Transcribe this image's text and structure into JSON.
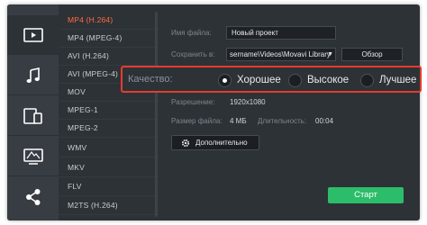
{
  "sidebar": {
    "tabs": [
      {
        "icon": "video-icon",
        "active": true
      },
      {
        "icon": "music-icon",
        "active": false
      },
      {
        "icon": "devices-icon",
        "active": false
      },
      {
        "icon": "tv-icon",
        "active": false
      },
      {
        "icon": "share-icon",
        "active": false
      }
    ]
  },
  "formats": {
    "items": [
      "MP4 (H.264)",
      "MP4 (MPEG-4)",
      "AVI (H.264)",
      "AVI (MPEG-4)",
      "MOV",
      "MPEG-1",
      "MPEG-2",
      "WMV",
      "MKV",
      "FLV",
      "M2TS (H.264)"
    ],
    "selected": "MP4 (H.264)"
  },
  "settings": {
    "filename_label": "Имя файла:",
    "filename_value": "Новый проект",
    "save_label": "Сохранить в:",
    "save_path": "sername\\Videos\\Movavi Library",
    "browse_label": "Обзор",
    "resolution_label": "Разрешение:",
    "resolution_value": "1920x1080",
    "filesize_label": "Размер файла:",
    "filesize_value": "4 МБ",
    "duration_label": "Длительность:",
    "duration_value": "00:04",
    "more_label": "Дополнительно",
    "start_label": "Старт"
  },
  "quality": {
    "label": "Качество:",
    "options": [
      {
        "label": "Хорошее",
        "selected": true
      },
      {
        "label": "Высокое",
        "selected": false
      },
      {
        "label": "Лучшее",
        "selected": false
      }
    ]
  },
  "colors": {
    "accent_selected": "#ff6b3d",
    "start_button": "#2cbd6a",
    "highlight_border": "#e63b2e",
    "background": "#2d3237"
  }
}
